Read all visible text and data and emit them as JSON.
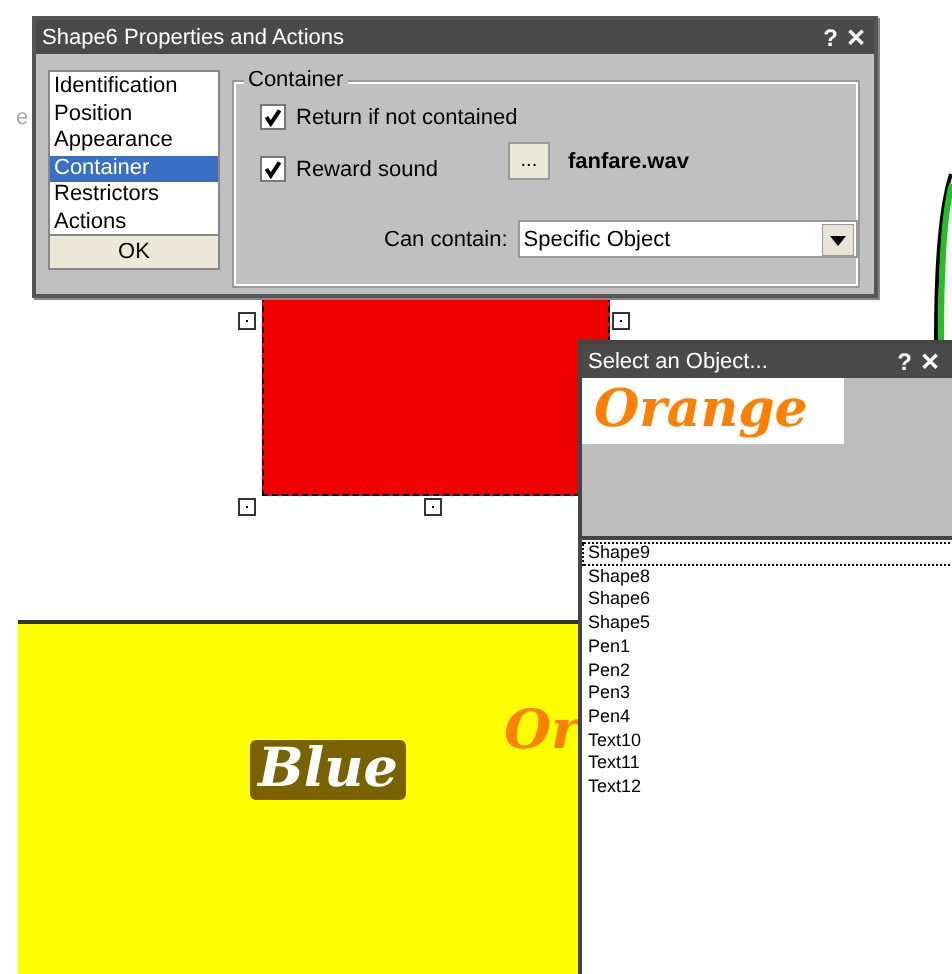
{
  "canvas": {
    "fragment": "e",
    "shapes": [
      {
        "kind": "red-rect",
        "selected": true
      },
      {
        "kind": "yellow-rect",
        "label": "Blue"
      },
      {
        "kind": "orange-text",
        "label": "Or"
      }
    ]
  },
  "properties_dialog": {
    "title": "Shape6 Properties and Actions",
    "help": "?",
    "close": "✕",
    "sections": [
      {
        "label": "Identification",
        "selected": false
      },
      {
        "label": "Position",
        "selected": false
      },
      {
        "label": "Appearance",
        "selected": false
      },
      {
        "label": "Container",
        "selected": true
      },
      {
        "label": "Restrictors",
        "selected": false
      },
      {
        "label": "Actions",
        "selected": false
      }
    ],
    "ok": "OK",
    "group": "Container",
    "return_if_not_contained": {
      "label": "Return if not contained",
      "checked": true
    },
    "reward_sound": {
      "label": "Reward sound",
      "checked": true
    },
    "browse": "...",
    "sound_file": "fanfare.wav",
    "can_contain_label": "Can contain:",
    "can_contain": "Specific Object"
  },
  "select_dialog": {
    "title": "Select an Object...",
    "help": "?",
    "close": "✕",
    "preview": "Orange",
    "objects": [
      {
        "label": "Shape9",
        "selected": true
      },
      {
        "label": "Shape8",
        "selected": false
      },
      {
        "label": "Shape6",
        "selected": false
      },
      {
        "label": "Shape5",
        "selected": false
      },
      {
        "label": "Pen1",
        "selected": false
      },
      {
        "label": "Pen2",
        "selected": false
      },
      {
        "label": "Pen3",
        "selected": false
      },
      {
        "label": "Pen4",
        "selected": false
      },
      {
        "label": "Text10",
        "selected": false
      },
      {
        "label": "Text11",
        "selected": false
      },
      {
        "label": "Text12",
        "selected": false
      }
    ]
  }
}
